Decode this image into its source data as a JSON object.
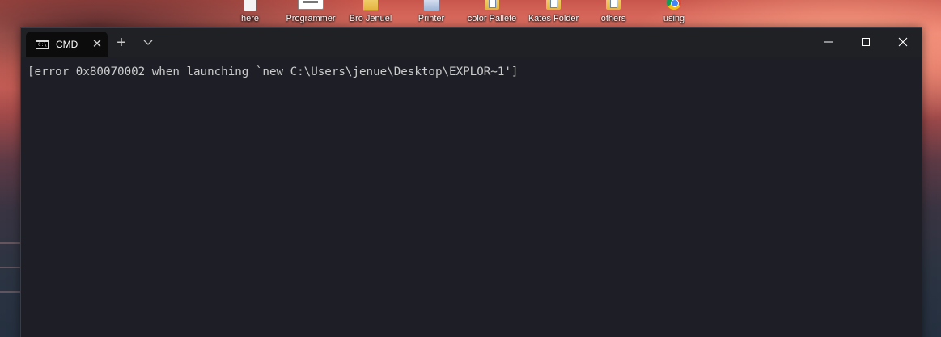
{
  "desktop": {
    "icons": [
      {
        "label": "here",
        "icon": "folder-icon"
      },
      {
        "label": "Programmer",
        "icon": "document-icon"
      },
      {
        "label": "Bro Jenuel",
        "icon": "folder-icon"
      },
      {
        "label": "Printer",
        "icon": "printer-icon"
      },
      {
        "label": "color Pallete",
        "icon": "folder-icon"
      },
      {
        "label": "Kates Folder",
        "icon": "folder-icon"
      },
      {
        "label": "others",
        "icon": "folder-icon"
      },
      {
        "label": "using",
        "icon": "chrome-icon"
      }
    ]
  },
  "terminal": {
    "tab": {
      "title": "CMD",
      "icon": "cmd-icon",
      "icon_text": "C:\\."
    },
    "output_lines": [
      "[error 0x80070002 when launching `new C:\\Users\\jenue\\Desktop\\EXPLOR~1']"
    ]
  },
  "colors": {
    "terminal_bg": "#1e1f26",
    "tabbar_bg": "#202124",
    "active_tab_bg": "#0c0c0c",
    "text": "#cccccc"
  }
}
